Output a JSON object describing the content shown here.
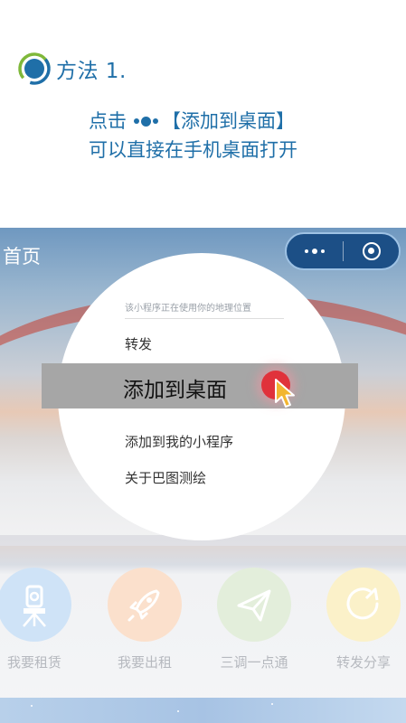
{
  "instruction": {
    "method_title": "方法 1.",
    "line1_prefix": "点击",
    "line1_suffix": "【添加到桌面】",
    "line2": "可以直接在手机桌面打开"
  },
  "app": {
    "title": "首页",
    "menu": {
      "hint": "该小程序正在使用你的地理位置",
      "items": {
        "forward": "转发",
        "add_to_desktop": "添加到桌面",
        "add_to_my_miniprograms": "添加到我的小程序",
        "about": "关于巴图测绘"
      }
    },
    "features": [
      {
        "label": "我要租赁",
        "icon": "surveying-instrument-icon",
        "color": "#cfe3f7"
      },
      {
        "label": "我要出租",
        "icon": "rocket-icon",
        "color": "#fbe0cc"
      },
      {
        "label": "三调一点通",
        "icon": "paper-plane-icon",
        "color": "#e3eedb"
      },
      {
        "label": "转发分享",
        "icon": "share-icon",
        "color": "#fbf1c9"
      }
    ]
  },
  "colors": {
    "accent_blue": "#1f6fa8",
    "capsule_bg": "#1c4f86",
    "tap_red": "#e0323b",
    "cursor_yellow": "#f2b631"
  }
}
